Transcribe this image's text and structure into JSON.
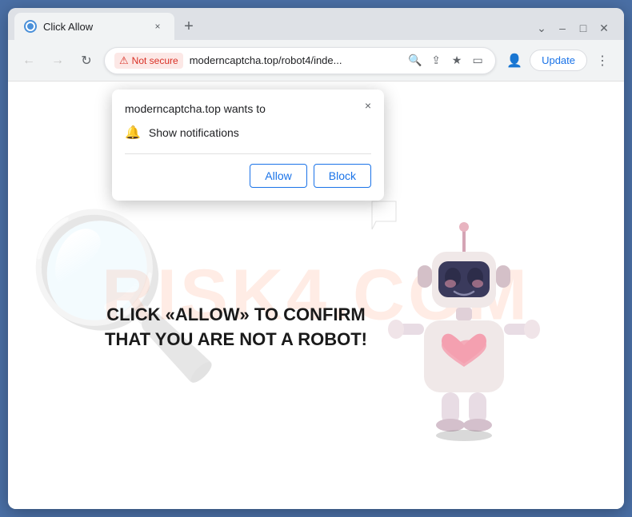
{
  "browser": {
    "tab_title": "Click Allow",
    "tab_close_label": "×",
    "new_tab_label": "+",
    "window_controls": {
      "minimize": "–",
      "maximize": "□",
      "close": "✕"
    },
    "nav": {
      "back": "←",
      "forward": "→",
      "refresh": "↺"
    },
    "not_secure_label": "Not secure",
    "url": "moderncaptcha.top/robot4/inde...",
    "update_button": "Update",
    "dots_menu": "⋮"
  },
  "popup": {
    "title": "moderncaptcha.top wants to",
    "close_icon": "×",
    "notification_text": "Show notifications",
    "allow_button": "Allow",
    "block_button": "Block"
  },
  "page": {
    "captcha_text": "CLICK «ALLOW» TO CONFIRM THAT YOU ARE NOT A ROBOT!",
    "watermark": "RISK4.COM"
  }
}
